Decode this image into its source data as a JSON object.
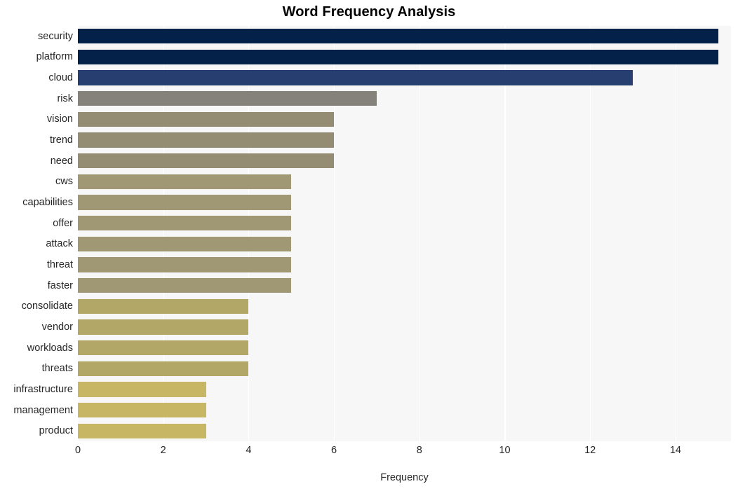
{
  "chart_data": {
    "type": "bar",
    "orientation": "horizontal",
    "title": "Word Frequency Analysis",
    "xlabel": "Frequency",
    "ylabel": "",
    "categories": [
      "security",
      "platform",
      "cloud",
      "risk",
      "vision",
      "trend",
      "need",
      "cws",
      "capabilities",
      "offer",
      "attack",
      "threat",
      "faster",
      "consolidate",
      "vendor",
      "workloads",
      "threats",
      "infrastructure",
      "management",
      "product"
    ],
    "values": [
      15,
      15,
      13,
      7,
      6,
      6,
      6,
      5,
      5,
      5,
      5,
      5,
      5,
      4,
      4,
      4,
      4,
      3,
      3,
      3
    ],
    "bar_colors": [
      "#042149",
      "#042149",
      "#263f70",
      "#84827b",
      "#948d74",
      "#948d74",
      "#948d74",
      "#a09775",
      "#a09775",
      "#a09775",
      "#a09775",
      "#a09775",
      "#a09775",
      "#b3a768",
      "#b3a768",
      "#b3a768",
      "#b3a768",
      "#c7b664",
      "#c7b664",
      "#c7b664"
    ],
    "xlim": [
      0,
      15.3
    ],
    "xticks": [
      0,
      2,
      4,
      6,
      8,
      10,
      12,
      14
    ],
    "xtick_labels": [
      "0",
      "2",
      "4",
      "6",
      "8",
      "10",
      "12",
      "14"
    ],
    "grid": "vertical-only",
    "legend": "none",
    "plot_background": "#f7f7f7",
    "gridline_color": "#ffffff",
    "figure_background": "#ffffff",
    "text_color": "#262626",
    "title_color": "#000000"
  }
}
